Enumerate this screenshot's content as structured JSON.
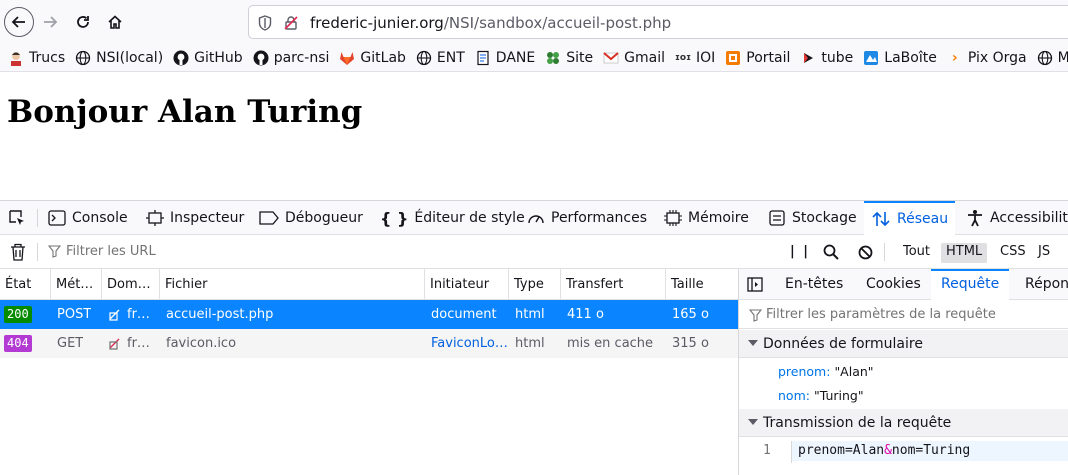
{
  "browser": {
    "url_host": "frederic-junier.org",
    "url_path": "/NSI/sandbox/accueil-post.php"
  },
  "bookmarks": [
    {
      "label": "Trucs",
      "icon": "avatar-icon"
    },
    {
      "label": "NSI(local)",
      "icon": "globe-icon"
    },
    {
      "label": "GitHub",
      "icon": "github-icon"
    },
    {
      "label": "parc-nsi",
      "icon": "github-icon"
    },
    {
      "label": "GitLab",
      "icon": "gitlab-icon"
    },
    {
      "label": "ENT",
      "icon": "globe-icon"
    },
    {
      "label": "DANE",
      "icon": "document-icon"
    },
    {
      "label": "Site",
      "icon": "puzzle-icon"
    },
    {
      "label": "Gmail",
      "icon": "gmail-icon"
    },
    {
      "label": "IOI",
      "icon": "ioi-icon"
    },
    {
      "label": "Portail",
      "icon": "portal-icon"
    },
    {
      "label": "tube",
      "icon": "play-icon"
    },
    {
      "label": "LaBoîte",
      "icon": "laboite-icon"
    },
    {
      "label": "Pix Orga",
      "icon": "pix-icon"
    },
    {
      "label": "Mo",
      "icon": "globe-icon"
    }
  ],
  "page": {
    "heading": "Bonjour Alan Turing"
  },
  "devtools": {
    "tabs": [
      "Console",
      "Inspecteur",
      "Débogueur",
      "Éditeur de style",
      "Performances",
      "Mémoire",
      "Stockage",
      "Réseau",
      "Accessibilité"
    ],
    "active_tab": "Réseau",
    "filter_placeholder": "Filtrer les URL",
    "type_filters": [
      "Tout",
      "HTML",
      "CSS",
      "JS"
    ],
    "selected_type": "HTML",
    "columns": [
      "État",
      "Mét…",
      "Dom…",
      "Fichier",
      "Initiateur",
      "Type",
      "Transfert",
      "Taille"
    ],
    "requests": [
      {
        "status": "200",
        "status_color": "#058b00",
        "method": "POST",
        "domain": "fr…",
        "file": "accueil-post.php",
        "initiator": "document",
        "type": "html",
        "transfer": "411 o",
        "size": "165 o"
      },
      {
        "status": "404",
        "status_color": "#b33bd4",
        "method": "GET",
        "domain": "fr…",
        "file": "favicon.ico",
        "initiator": "FaviconLo…",
        "type": "html",
        "transfer": "mis en cache",
        "size": "315 o"
      }
    ],
    "side_tabs": [
      "En-têtes",
      "Cookies",
      "Requête",
      "Répons"
    ],
    "active_side_tab": "Requête",
    "side_filter_placeholder": "Filtrer les paramètres de la requête",
    "form_section_title": "Données de formulaire",
    "form_params": [
      {
        "key": "prenom:",
        "value": "\"Alan\""
      },
      {
        "key": "nom:",
        "value": "\"Turing\""
      }
    ],
    "transmission_title": "Transmission de la requête",
    "payload_line_number": "1",
    "payload": {
      "p1": "prenom=Alan",
      "amp": "&",
      "p2": "nom=Turing"
    }
  }
}
